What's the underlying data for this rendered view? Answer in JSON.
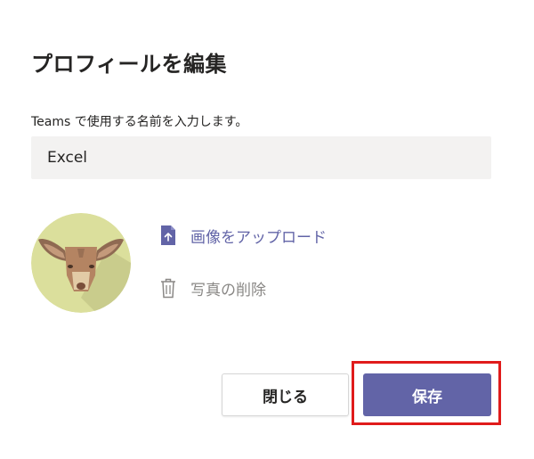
{
  "dialog": {
    "title": "プロフィールを編集",
    "name_label": "Teams で使用する名前を入力します。",
    "name_value": "Excel",
    "upload_label": "画像をアップロード",
    "delete_label": "写真の削除",
    "close_label": "閉じる",
    "save_label": "保存"
  },
  "icons": {
    "avatar": "deer-avatar",
    "upload": "file-upload-icon",
    "delete": "trash-icon"
  },
  "colors": {
    "accent": "#6264a7",
    "avatar_bg": "#dbdf9c",
    "highlight": "#e01b1b",
    "input_bg": "#f3f2f1",
    "muted_text": "#8a8886"
  }
}
